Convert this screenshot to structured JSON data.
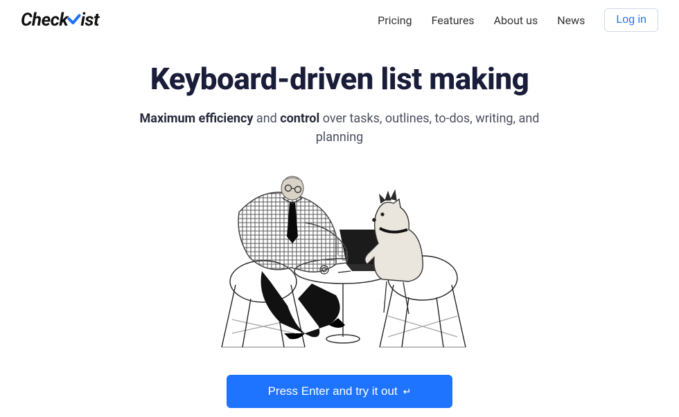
{
  "brand": {
    "part1": "Check",
    "part2": "ist"
  },
  "nav": {
    "items": [
      "Pricing",
      "Features",
      "About us",
      "News"
    ],
    "login": "Log in"
  },
  "hero": {
    "title": "Keyboard-driven list making",
    "sub_bold1": "Maximum efficiency",
    "sub_mid1": " and ",
    "sub_bold2": "control",
    "sub_rest": " over tasks, outlines, to-dos, writing, and planning"
  },
  "cta": {
    "label": "Press Enter and try it out",
    "icon": "↵"
  }
}
